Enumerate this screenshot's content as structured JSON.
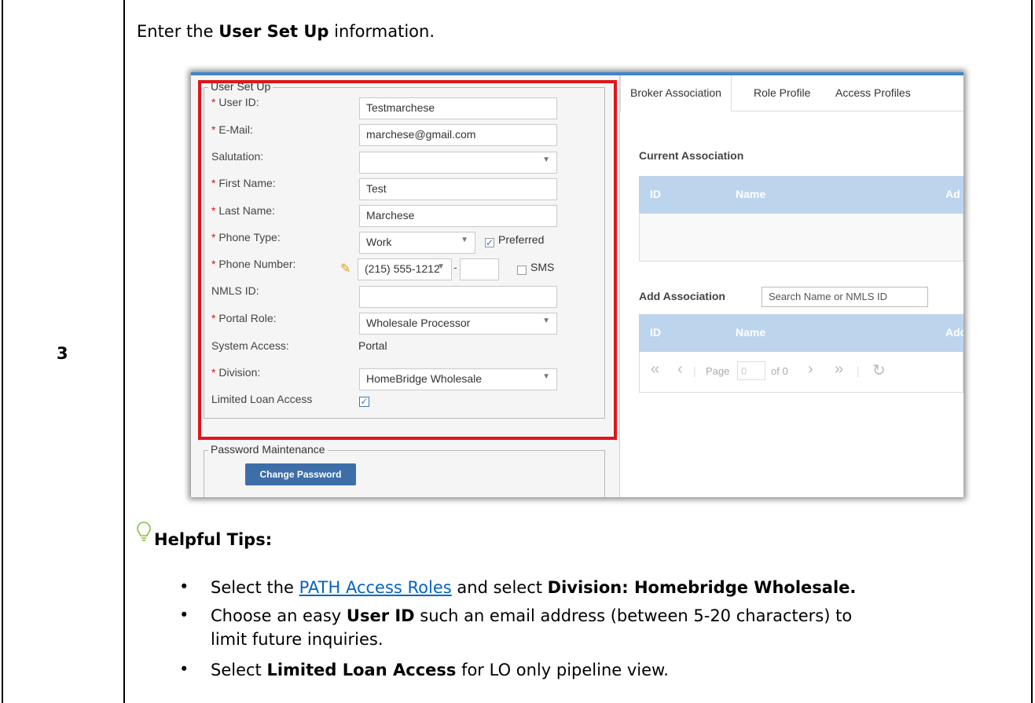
{
  "step": {
    "number": "3",
    "title_prefix": "Enter the ",
    "title_bold": "User Set Up",
    "title_suffix": " information."
  },
  "user_set_up": {
    "legend": "User Set Up",
    "fields": {
      "user_id": {
        "label": "User ID:",
        "value": "Testmarchese"
      },
      "email": {
        "label": "E-Mail:",
        "value": "marchese@gmail.com"
      },
      "salutation": {
        "label": "Salutation:",
        "value": ""
      },
      "first_name": {
        "label": "First Name:",
        "value": "Test"
      },
      "last_name": {
        "label": "Last Name:",
        "value": "Marchese"
      },
      "phone_type": {
        "label": "Phone Type:",
        "value": "Work",
        "preferred_label": "Preferred"
      },
      "phone_number": {
        "label": "Phone Number:",
        "value": "(215) 555-1212",
        "ext": "",
        "sms_label": "SMS"
      },
      "nmls_id": {
        "label": "NMLS ID:",
        "value": ""
      },
      "portal_role": {
        "label": "Portal Role:",
        "value": "Wholesale Processor"
      },
      "system_access": {
        "label": "System Access:",
        "value": "Portal"
      },
      "division": {
        "label": "Division:",
        "value": "HomeBridge Wholesale"
      },
      "limited_loan_access": {
        "label": "Limited Loan Access"
      }
    },
    "required_marker": "*"
  },
  "password": {
    "legend": "Password Maintenance",
    "button": "Change Password"
  },
  "tabs": [
    "Broker Association",
    "Role Profile",
    "Access Profiles"
  ],
  "current_association": {
    "title": "Current Association",
    "columns": [
      "ID",
      "Name",
      "Ad"
    ]
  },
  "add_association": {
    "title": "Add Association",
    "search_placeholder": "Search Name or NMLS ID",
    "columns": [
      "ID",
      "Name",
      "Add"
    ],
    "pager": {
      "page_label": "Page",
      "page_value": "0",
      "of_label": "of 0"
    }
  },
  "tips": {
    "heading": "Helpful Tips:",
    "items": [
      {
        "pre": "Select the ",
        "link": "PATH Access Roles",
        "mid": " and select ",
        "bold": "Division: Homebridge Wholesale.",
        "post": ""
      },
      {
        "pre": "Choose an easy ",
        "bold": "User ID",
        "post": " such an email address  (between 5-20 characters) to",
        "line2": "limit future inquiries."
      },
      {
        "pre": "Select ",
        "bold": "Limited Loan Access",
        "post": " for LO only pipeline view."
      }
    ]
  },
  "colors": {
    "accent": "#3f86c9",
    "highlight": "#e1141b",
    "button": "#3d6ea8",
    "link": "#0563c1"
  }
}
